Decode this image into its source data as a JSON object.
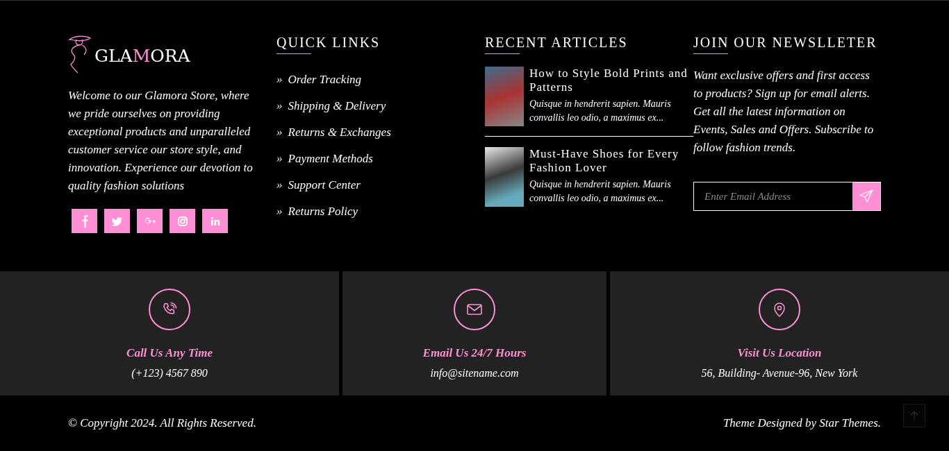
{
  "brand": {
    "logo_parts": [
      {
        "text": "GLA",
        "accent": false
      },
      {
        "text": "M",
        "accent": true
      },
      {
        "text": "ORA",
        "accent": false
      }
    ],
    "description": "Welcome to our Glamora Store, where we pride ourselves on providing exceptional products and unparalleled customer service our store style, and innovation. Experience our devotion to quality fashion solutions",
    "social": [
      {
        "kind": "facebook"
      },
      {
        "kind": "twitter"
      },
      {
        "kind": "google-plus"
      },
      {
        "kind": "instagram"
      },
      {
        "kind": "linkedin"
      }
    ]
  },
  "quick_links": {
    "title": "QUICK LINKS",
    "marker": "»",
    "items": [
      "Order Tracking",
      "Shipping & Delivery",
      "Returns & Exchanges",
      "Payment Methods",
      "Support Center",
      "Returns Policy"
    ]
  },
  "recent_articles": {
    "title": "RECENT ARTICLES",
    "items": [
      {
        "title": "How to Style Bold Prints and Patterns",
        "excerpt": "Quisque in hendrerit sapien. Mauris convallis leo odio, a maximus ex..."
      },
      {
        "title": "Must-Have Shoes for Every Fashion Lover",
        "excerpt": "Quisque in hendrerit sapien. Mauris convallis leo odio, a maximus ex..."
      }
    ]
  },
  "newsletter": {
    "title": "JOIN OUR NEWSLLETER",
    "text": "Want exclusive offers and first access to products? Sign up for email alerts. Get all the latest information on Events, Sales and Offers. Subscribe to follow fashion trends.",
    "placeholder": "Enter Email Address"
  },
  "contacts": [
    {
      "kind": "phone",
      "title": "Call Us Any Time",
      "detail": "(+123) 4567 890"
    },
    {
      "kind": "email",
      "title": "Email Us 24/7 Hours",
      "detail": "info@sitename.com"
    },
    {
      "kind": "location",
      "title": "Visit Us Location",
      "detail": "56, Building- Avenue-96, New York"
    }
  ],
  "bottom_bar": {
    "copyright": "© Copyright 2024. All Rights Reserved.",
    "credit": "Theme Designed by Star Themes."
  }
}
